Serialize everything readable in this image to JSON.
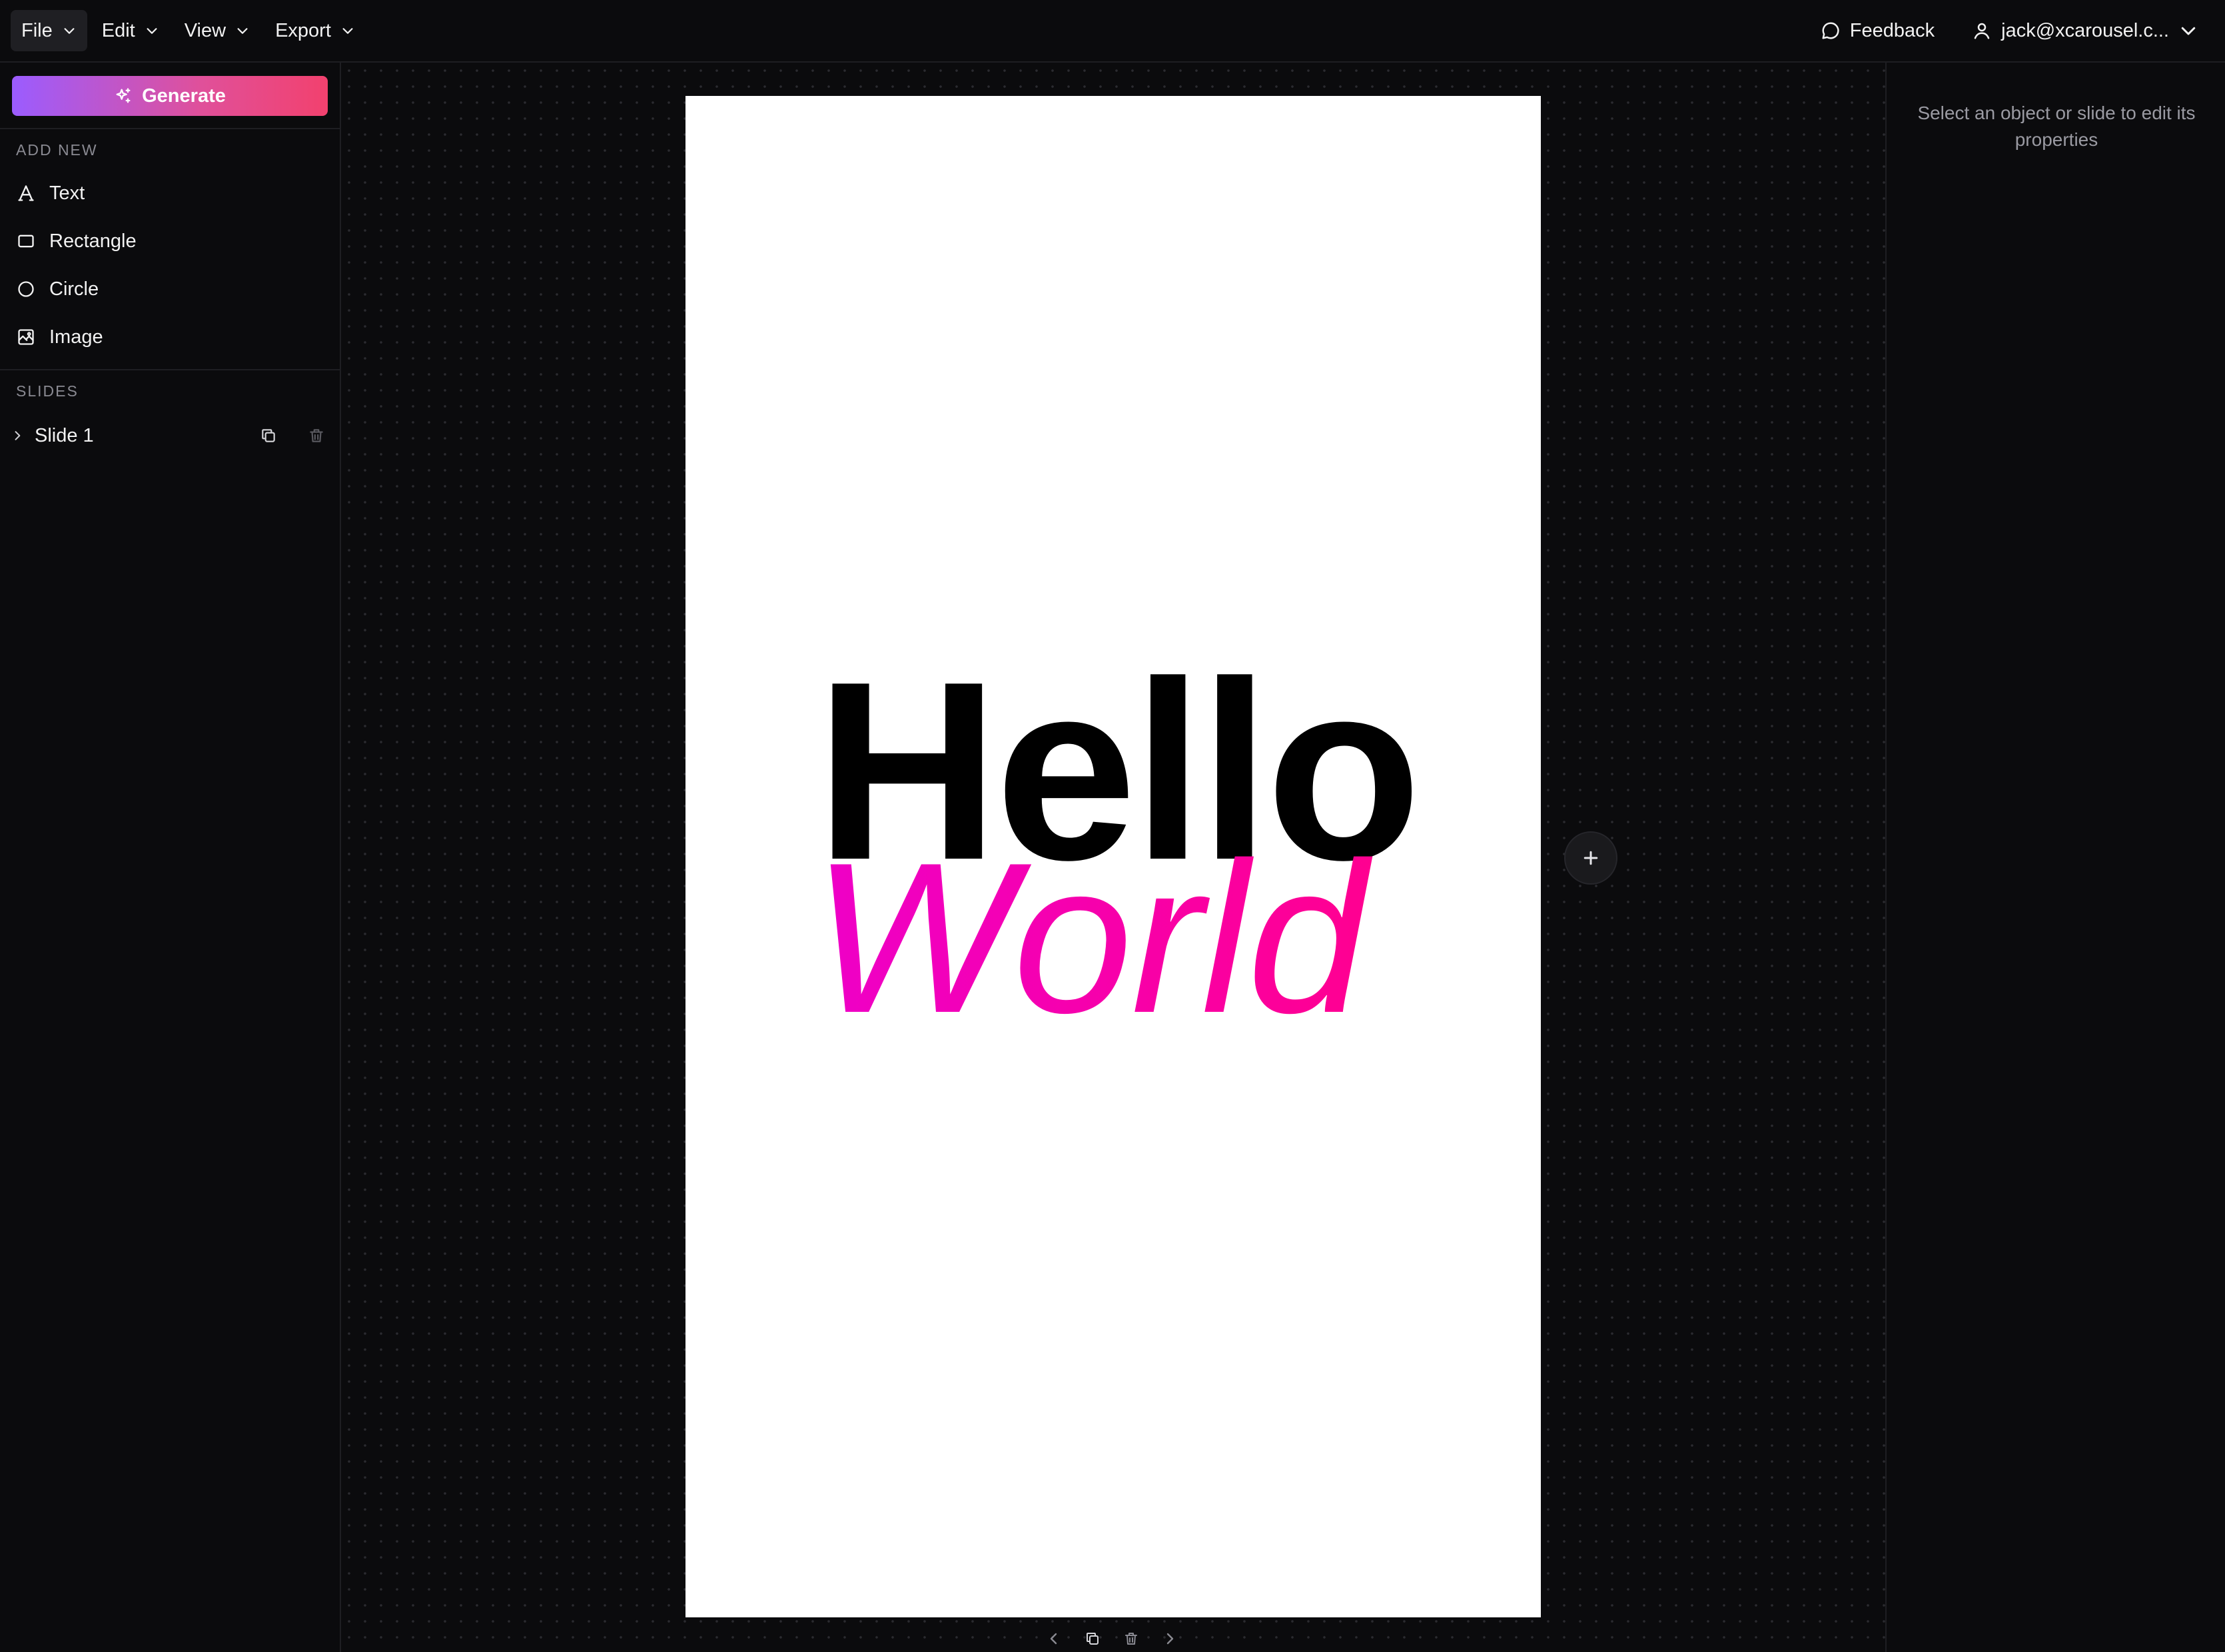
{
  "topbar": {
    "menus": [
      {
        "label": "File"
      },
      {
        "label": "Edit"
      },
      {
        "label": "View"
      },
      {
        "label": "Export"
      }
    ],
    "feedback_label": "Feedback",
    "account_label": "jack@xcarousel.c..."
  },
  "sidebar": {
    "generate_label": "Generate",
    "add_new_title": "ADD NEW",
    "add_items": [
      {
        "label": "Text",
        "icon": "text-icon"
      },
      {
        "label": "Rectangle",
        "icon": "rectangle-icon"
      },
      {
        "label": "Circle",
        "icon": "circle-icon"
      },
      {
        "label": "Image",
        "icon": "image-icon"
      }
    ],
    "slides_title": "SLIDES",
    "slides": [
      {
        "label": "Slide 1"
      }
    ]
  },
  "canvas": {
    "slide": {
      "line1": "Hello",
      "line2": "World",
      "line1_color": "#000000",
      "line2_gradient": [
        "#ee00c8",
        "#ff0090"
      ],
      "background": "#ffffff"
    }
  },
  "properties": {
    "hint": "Select an object or slide to edit its properties"
  },
  "colors": {
    "app_background": "#0b0b0d",
    "generate_gradient": [
      "#9b5cff",
      "#f2416e"
    ],
    "text_muted": "#9a9aa2"
  }
}
